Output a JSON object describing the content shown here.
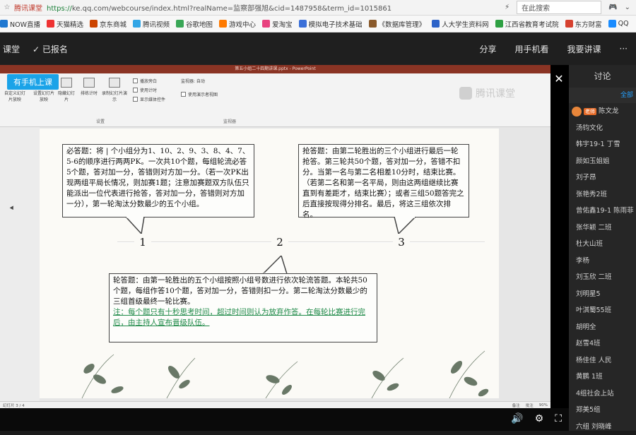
{
  "browser": {
    "site_name": "腾讯课堂",
    "url_prefix": "https://",
    "url_rest": "ke.qq.com/webcourse/index.html?realName=监察部强旭&cid=1487958&term_id=1015861",
    "search_label": "在此搜索",
    "bookmarks": [
      "NOW直播",
      "天猫精选",
      "京东商城",
      "腾讯视频",
      "谷歌地图",
      "游戏中心",
      "爱淘宝",
      "模拟电子技术基础",
      "《数据库管理》",
      "人大学生资料网",
      "江西省教育考试院",
      "东方财富",
      "QQ"
    ]
  },
  "classbar": {
    "left_items": [
      "课堂",
      "✓ 已报名"
    ],
    "right_items": [
      "分享",
      "用手机看",
      "我要讲课",
      "···"
    ]
  },
  "stage": {
    "teacher_tag": "有手机上课",
    "ppt_title": "第五小组二十四期讲课.pptx - PowerPoint",
    "brand_name": "腾讯课堂",
    "ribbon": {
      "groups": [
        {
          "label": "自定义幻灯片放映",
          "icon": "slideshow-icon"
        },
        {
          "label": "设置幻灯片放映",
          "icon": "setup-icon"
        },
        {
          "label": "隐藏幻灯片",
          "icon": "hide-icon"
        },
        {
          "label": "排练计时",
          "icon": "timer-icon"
        },
        {
          "label": "录制幻灯片演示",
          "icon": "record-icon"
        }
      ],
      "checks": [
        "播放旁白",
        "使用计时",
        "显示媒体控件"
      ],
      "checks_right": [
        "使用演示者视图"
      ],
      "monitor_label": "监视器: 自动",
      "group_setup": "设置",
      "group_monitor": "监视器"
    },
    "status": {
      "left": "幻灯片 3 / 4",
      "notes": "备注",
      "comments": "批注",
      "zoom": "90%"
    }
  },
  "slide": {
    "box1": "必答题：将 | 个小组分为1、10、2、9、3、8、4、7、5-6的顺序进行两两PK。一次共10个题，每组轮流必答5个题，答对加一分，答错则对方加一分。（若一次PK出现两组平局长情况，则加赛1题；注意加赛题双方队伍只能派出一位代表进行抢答，答对加一分，答错则对方加一分），第一轮淘汰分数最少的五个小组。",
    "box2": "抢答题：由第二轮胜出的三个小组进行最后一轮抢答。第三轮共50个题，答对加一分，答错不扣分。当第一名与第二名相差10分时，结束比赛。（若第二名和第一名平局，则由这两组继续比赛直到有差距才，结束比赛）；或者三组50题答完之后直接按现得分排名。最后，将这三组依次排名。",
    "box3": "轮答题：由第一轮胜出的五个小组按照小组号数进行依次轮流答题。本轮共50个题，每组作答10个题，答对加一分，答错则扣一分。第二轮淘汰分数最少的三组首级最终一轮比赛。",
    "note": "注：每个题只有十秒思考时间，超过时间则认为放弃作答。在每轮比赛进行完后，由主持人宣布晋级队伍。",
    "nodes": [
      "1",
      "2",
      "3"
    ]
  },
  "panel": {
    "title": "讨论",
    "sub": "全部",
    "teacher_badge": "老师",
    "teacher_name": "陈文龙",
    "members": [
      "汤钧文化",
      "韩宇19-1 丁雪",
      "颜如玉姐姐",
      "刘子昂",
      "张艳秀2班",
      "曾佑鑫19-1 陈雨菲",
      "张华颖 二班",
      "杜大山班",
      "李杨",
      "刘玉欣 二班",
      "刘明星5",
      "叶淇蜀55班",
      "胡明全",
      "赵雪4班",
      "杨佳佳 人民",
      "黄鹏 1班",
      "4组社会上站",
      "郑美5组",
      "六组 刘晓峰"
    ]
  }
}
